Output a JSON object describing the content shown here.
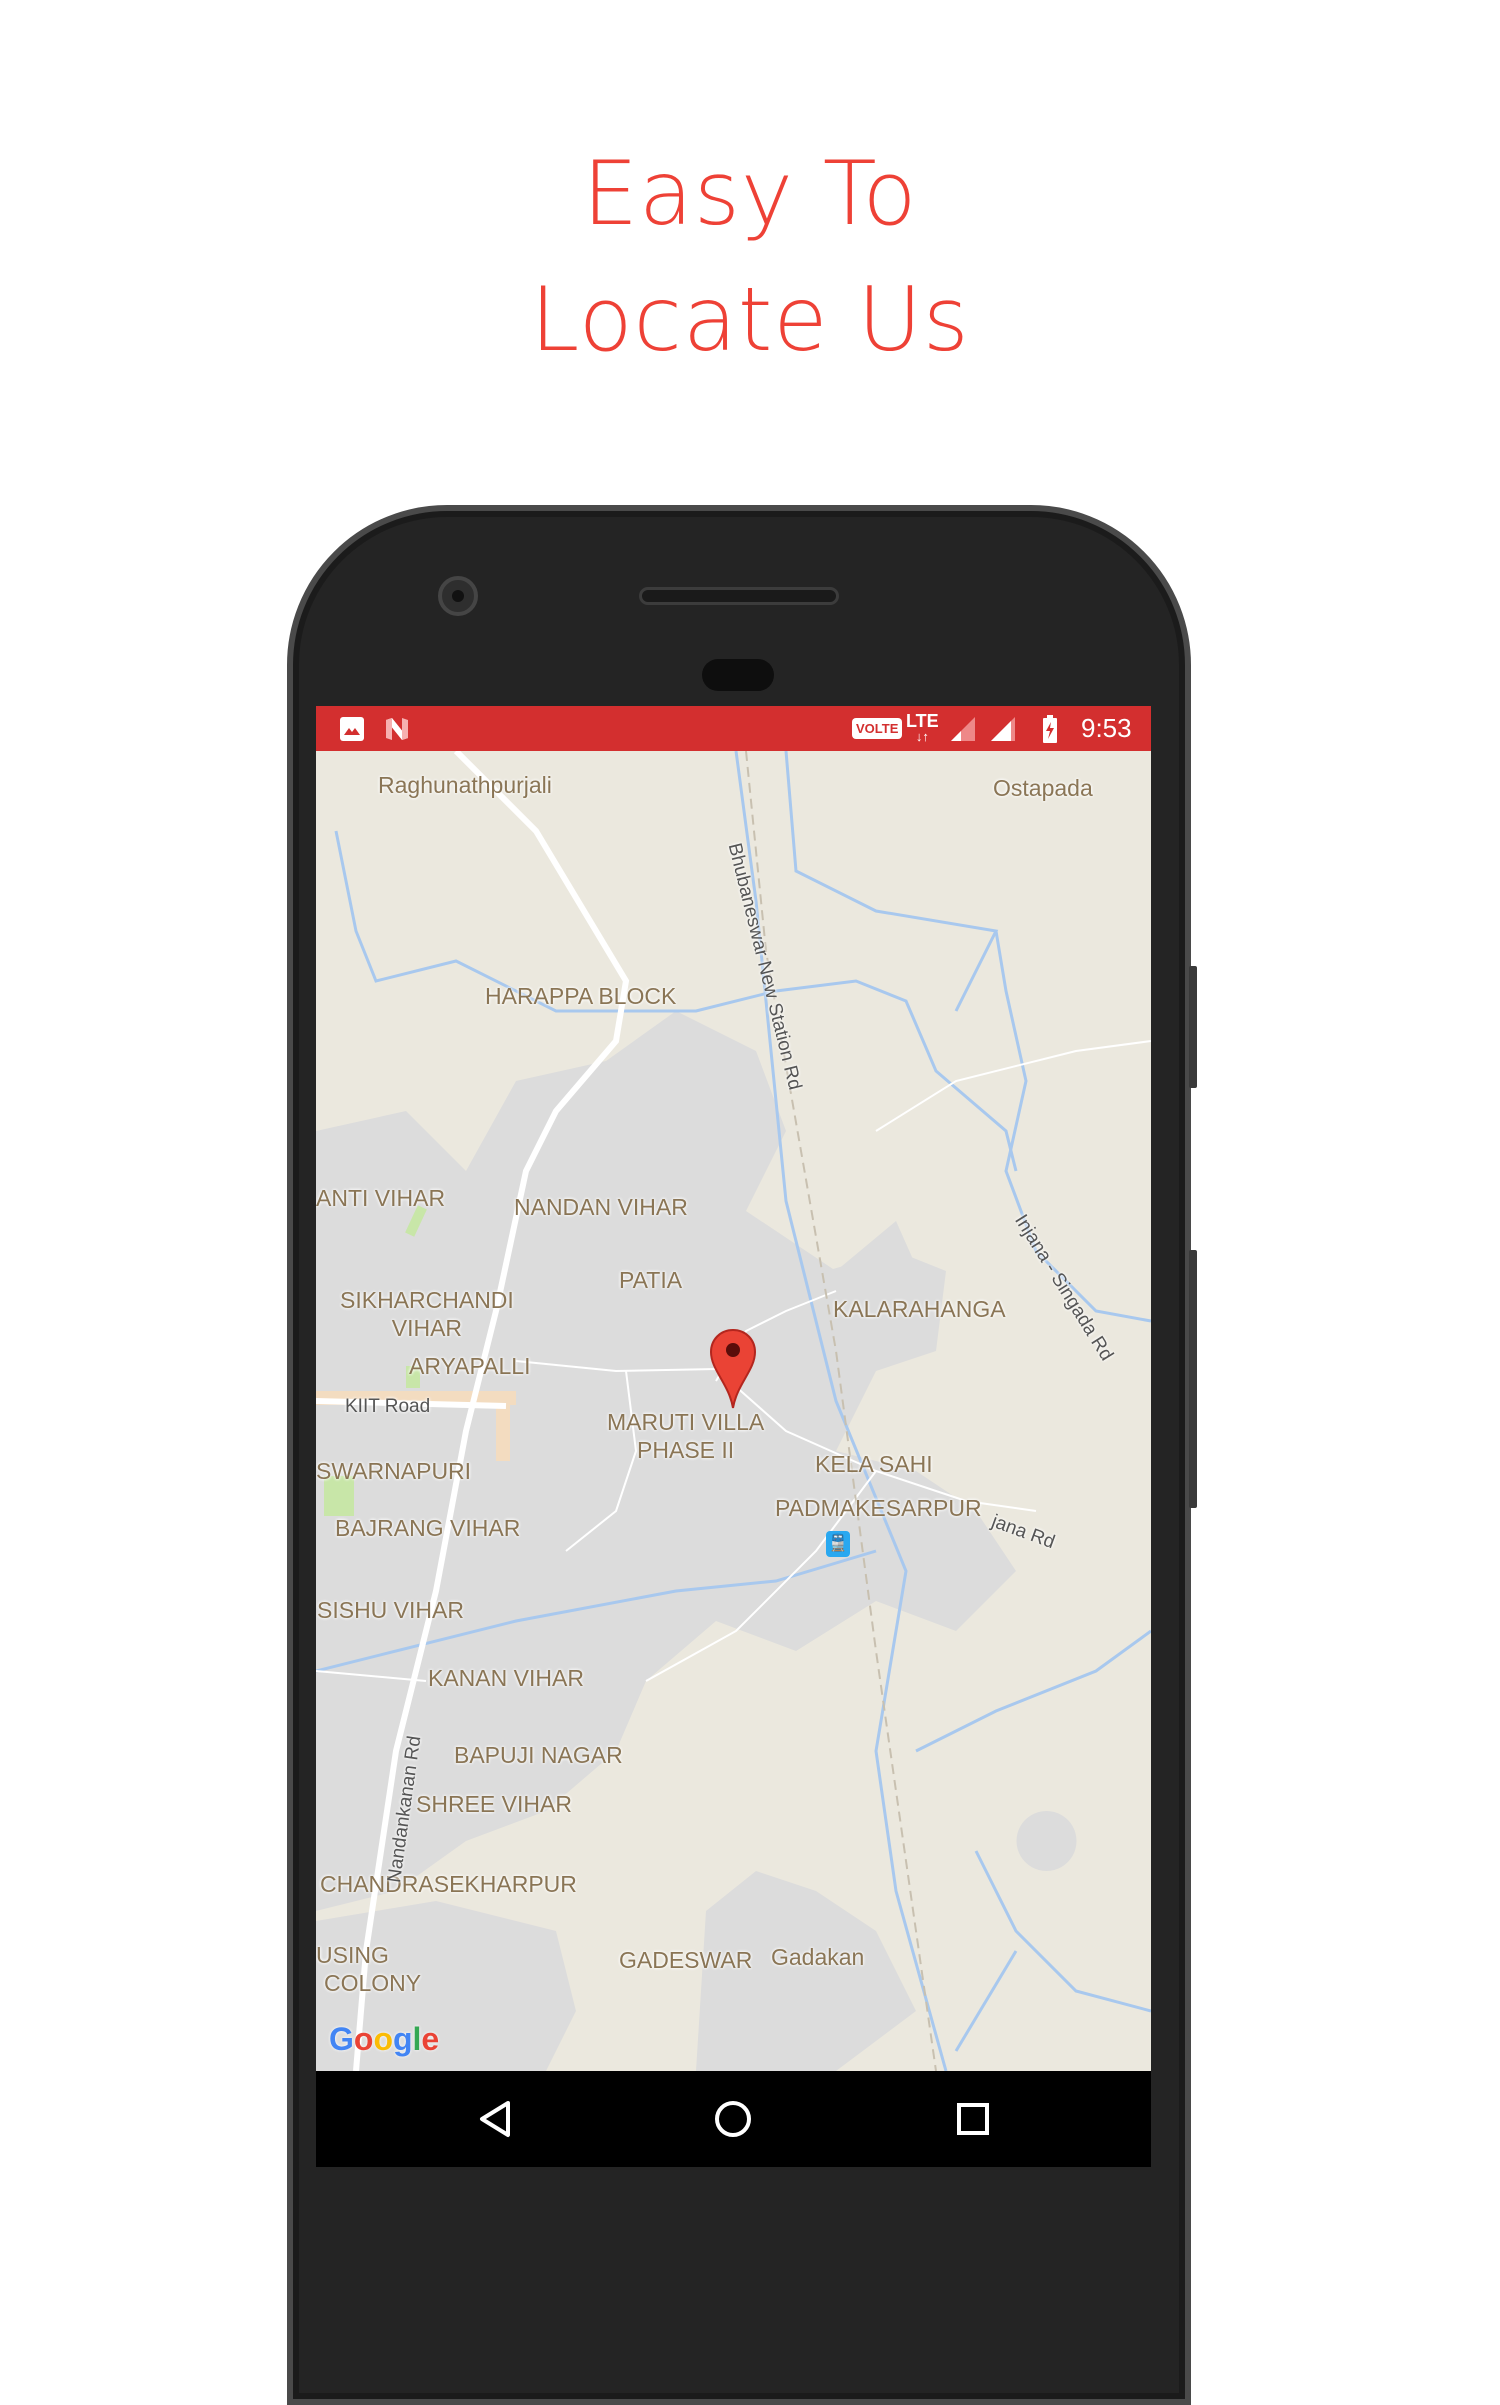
{
  "headline": {
    "line1": "Easy To",
    "line2": "Locate Us"
  },
  "colors": {
    "accent": "#ee4136",
    "status_bar": "#d32f2f",
    "pin": "#ea4335"
  },
  "status_bar": {
    "left_icons": [
      "image-icon",
      "n-notification-icon"
    ],
    "volte": "VOLTE",
    "lte": "LTE",
    "time": "9:53",
    "right_icons": [
      "signal-icon",
      "signal-icon",
      "battery-charging-icon"
    ]
  },
  "map": {
    "places": {
      "raghunathpurjali": "Raghunathpurjali",
      "ostapada": "Ostapada",
      "harappa": "HARAPPA BLOCK",
      "anti_vihar": "ANTI VIHAR",
      "nandan_vihar": "NANDAN VIHAR",
      "patia": "PATIA",
      "sikharchandi_1": "SIKHARCHANDI",
      "sikharchandi_2": "VIHAR",
      "kalarahanga": "KALARAHANGA",
      "aryapalli": "ARYAPALLI",
      "maruti_1": "MARUTI VILLA",
      "maruti_2": "PHASE II",
      "kela_sahi": "KELA SAHI",
      "swarnapuri": "SWARNAPURI",
      "padmakesarpur": "PADMAKESARPUR",
      "bajrang_vihar": "BAJRANG VIHAR",
      "sishu_vihar": "SISHU VIHAR",
      "kanan_vihar": "KANAN VIHAR",
      "bapuji_nagar": "BAPUJI NAGAR",
      "shree_vihar": "SHREE VIHAR",
      "chandrasekharpur": "CHANDRASEKHARPUR",
      "using_1": "USING",
      "using_2": "COLONY",
      "gadeswar": "GADESWAR",
      "gadakan": "Gadakan"
    },
    "roads": {
      "station_rd": "Bhubaneswar New Station Rd",
      "injana": "Injana - Singada Rd",
      "jana": "jana Rd",
      "kiit": "KIIT Road",
      "nandankanan": "Nandankanan Rd"
    },
    "logo": "Google"
  },
  "nav_bar": {
    "icons": [
      "back-icon",
      "home-icon",
      "recents-icon"
    ]
  }
}
